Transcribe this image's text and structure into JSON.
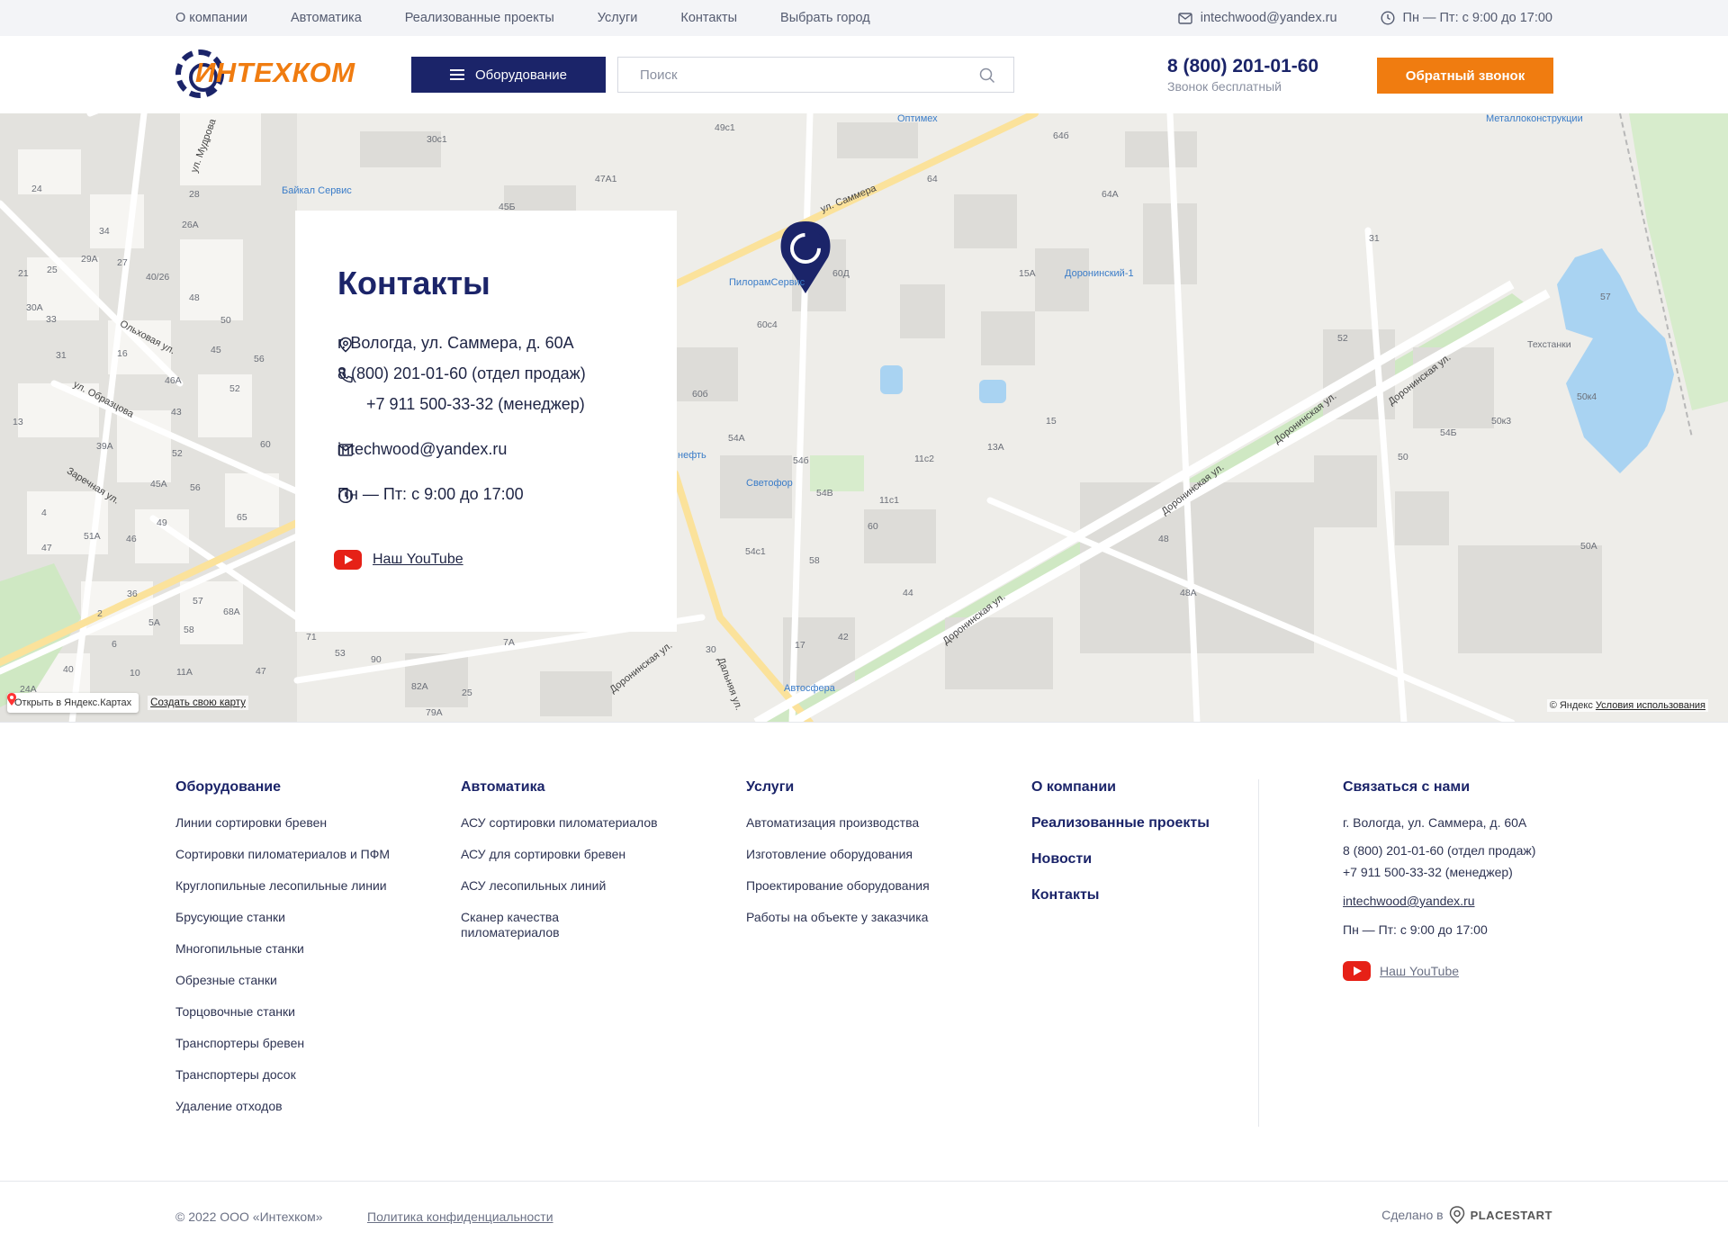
{
  "topbar": {
    "nav": [
      "О компании",
      "Автоматика",
      "Реализованные проекты",
      "Услуги",
      "Контакты",
      "Выбрать город"
    ],
    "email": "intechwood@yandex.ru",
    "hours": "Пн — Пт: с 9:00 до 17:00"
  },
  "header": {
    "logo_text": "ИНТЕХКОМ",
    "equipment_label": "Оборудование",
    "search_placeholder": "Поиск",
    "phone": "8 (800) 201-01-60",
    "phone_note": "Звонок бесплатный",
    "callback_label": "Обратный звонок"
  },
  "map": {
    "open_label": "Открыть в Яндекс.Картах",
    "create_label": "Создать свою карту",
    "copyright": "© Яндекс",
    "terms": "Условия использования",
    "streets": [
      "ул. Саммера",
      "Доронинская ул.",
      "Доронинская ул.",
      "Доронинская ул.",
      "Доронинская ул.",
      "Дальняя ул.",
      "ул. Образцова",
      "Ольховая ул.",
      "Заречная ул.",
      "ул. Мудрова",
      "Доронинская ул."
    ],
    "pois": [
      "Оптимех",
      "Металлоконструкции",
      "Байкал Сервис",
      "ПилорамСервис",
      "Доронинский-1",
      "Техстанки",
      "Светофор",
      "Автосфера",
      "нефть"
    ],
    "house_numbers": [
      "30с1",
      "49с1",
      "47А1",
      "45Б",
      "64б",
      "64",
      "64А",
      "31",
      "60Д",
      "15А",
      "57",
      "52",
      "60с4",
      "60б",
      "54А",
      "54б",
      "54В",
      "11с2",
      "11с1",
      "13А",
      "15",
      "60",
      "50",
      "54Б",
      "50к3",
      "50к4",
      "48",
      "48А",
      "50А",
      "58",
      "54с1",
      "44",
      "42",
      "17",
      "30",
      "7А",
      "82А",
      "25",
      "79А",
      "53",
      "90",
      "71",
      "24",
      "34",
      "25",
      "27",
      "29А",
      "30А",
      "31",
      "16",
      "45",
      "56",
      "46А",
      "52",
      "43",
      "39А",
      "52",
      "60",
      "45А",
      "56",
      "65",
      "51А",
      "46",
      "49",
      "47",
      "36",
      "57",
      "68А",
      "5А",
      "58",
      "6",
      "10",
      "11А",
      "47",
      "40",
      "24А",
      "40/26",
      "48",
      "50",
      "28",
      "26А",
      "33",
      "21",
      "13",
      "4",
      "2"
    ]
  },
  "contacts_card": {
    "title": "Контакты",
    "address": "г. Вологда, ул. Саммера, д. 60А",
    "phone_sales": "8 (800) 201-01-60 (отдел продаж)",
    "phone_manager": "+7 911 500-33-32 (менеджер)",
    "email": "intechwood@yandex.ru",
    "hours": "Пн — Пт: с 9:00 до 17:00",
    "youtube": "Наш YouTube"
  },
  "footer": {
    "equipment": {
      "title": "Оборудование",
      "links": [
        "Линии сортировки бревен",
        "Сортировки пиломатериалов и ПФМ",
        "Круглопильные лесопильные линии",
        "Брусующие станки",
        "Многопильные станки",
        "Обрезные станки",
        "Торцовочные станки",
        "Транспортеры бревен",
        "Транспортеры досок",
        "Удаление отходов"
      ]
    },
    "automation": {
      "title": "Автоматика",
      "links": [
        "АСУ сортировки пиломатериалов",
        "АСУ для сортировки бревен",
        "АСУ лесопильных линий",
        "Сканер качества пиломатериалов"
      ]
    },
    "services": {
      "title": "Услуги",
      "links": [
        "Автоматизация производства",
        "Изготовление оборудования",
        "Проектирование оборудования",
        "Работы на объекте у заказчика"
      ]
    },
    "company": {
      "links": [
        "О компании",
        "Реализованные проекты",
        "Новости",
        "Контакты"
      ]
    },
    "contact": {
      "title": "Связаться с нами",
      "address": "г. Вологда, ул. Саммера, д. 60А",
      "phone_sales": "8 (800) 201-01-60 (отдел продаж)",
      "phone_manager": "+7 911 500-33-32 (менеджер)",
      "email": "intechwood@yandex.ru",
      "hours": "Пн — Пт: с 9:00 до 17:00",
      "youtube": "Наш YouTube"
    },
    "copyright": "© 2022 ООО «Интехком»",
    "policy": "Политика конфиденциальности",
    "made_by": "Сделано в",
    "made_brand": "PLACESTART"
  },
  "colors": {
    "brand_navy": "#1b2469",
    "brand_orange": "#f07c10",
    "youtube_red": "#e62117"
  }
}
